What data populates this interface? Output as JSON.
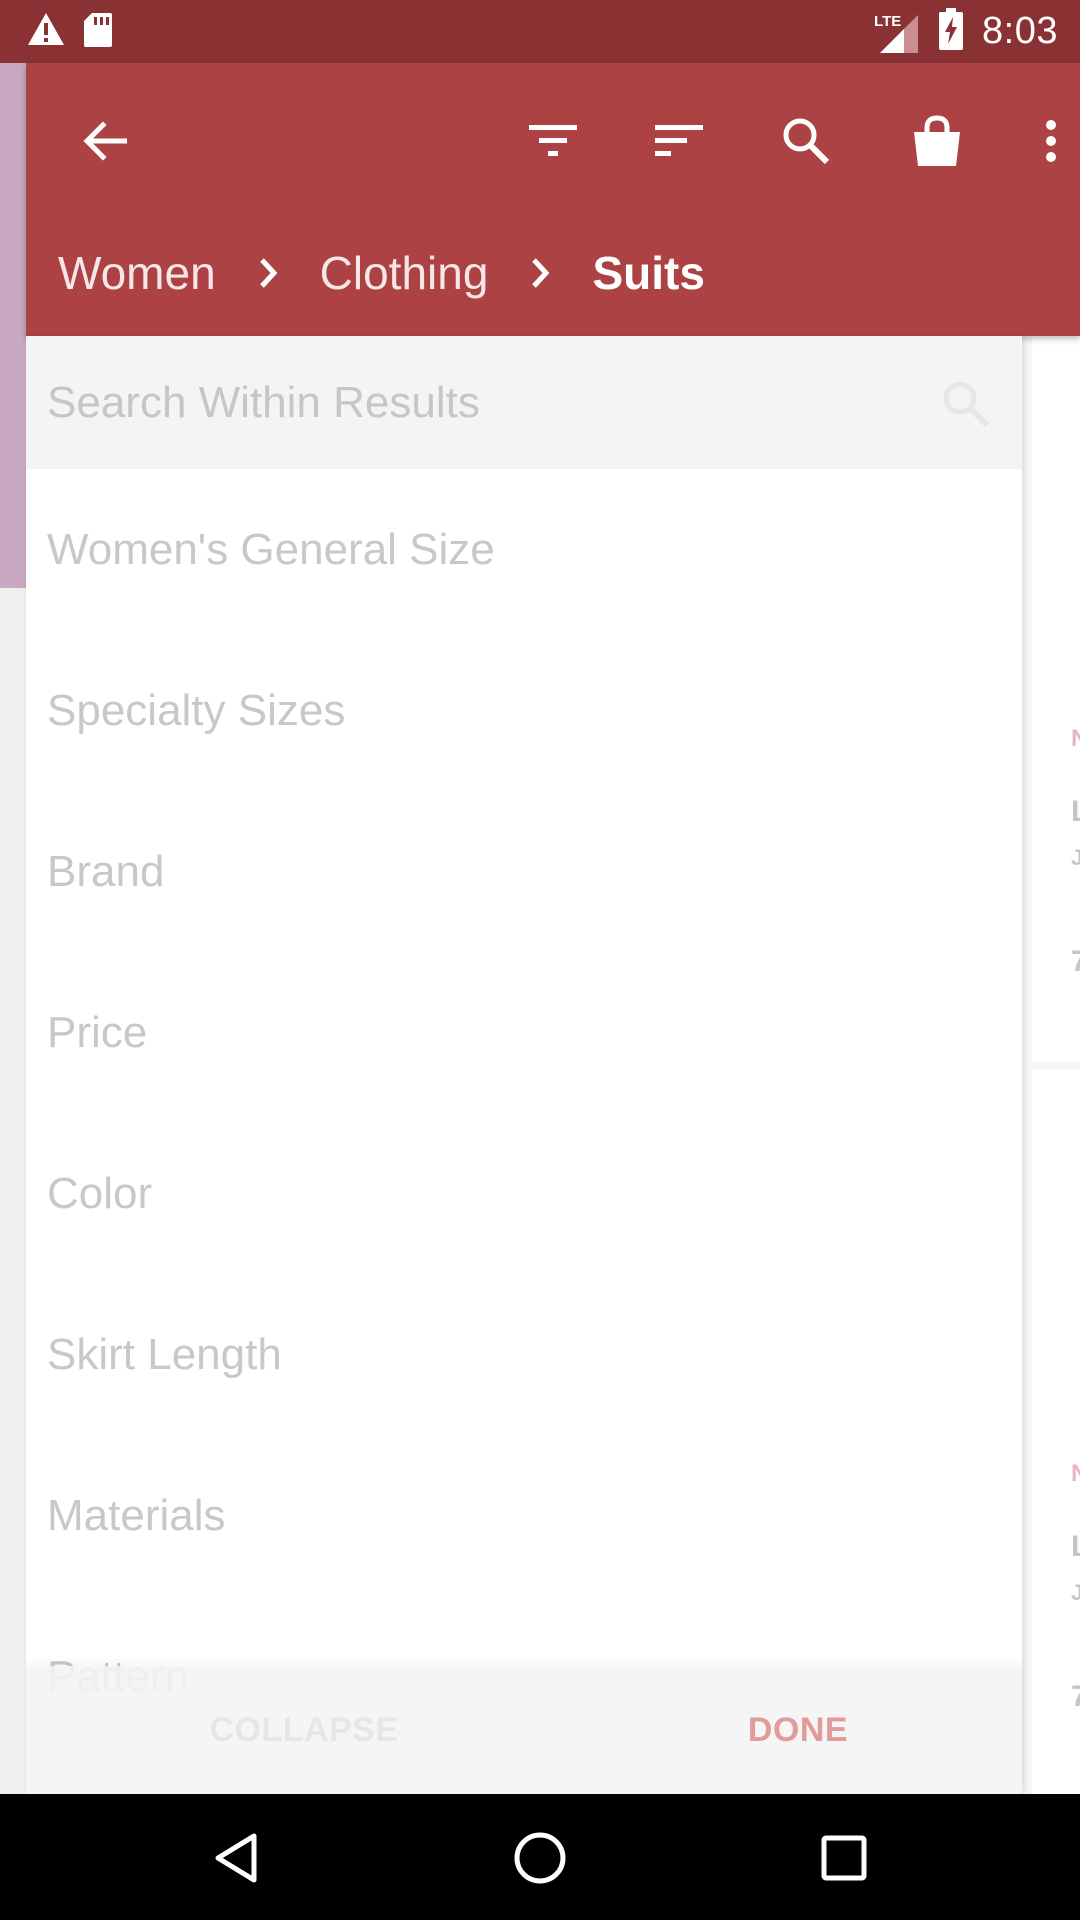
{
  "status_bar": {
    "time": "8:03",
    "network": "LTE",
    "icons": [
      "warning-icon",
      "sd-card-icon",
      "signal-icon",
      "battery-charging-icon"
    ]
  },
  "app_bar": {
    "icons": [
      "back-arrow-icon",
      "filter-icon",
      "sort-icon",
      "search-icon",
      "shopping-bag-icon",
      "more-vert-icon"
    ],
    "breadcrumb": [
      "Women",
      "Clothing",
      "Suits"
    ]
  },
  "filter_drawer": {
    "search_placeholder": "Search Within Results",
    "facets": [
      "Women's General Size",
      "Specialty Sizes",
      "Brand",
      "Price",
      "Color",
      "Skirt Length",
      "Materials",
      "Pattern"
    ],
    "collapse_label": "COLLAPSE",
    "done_label": "DONE"
  },
  "background_page": {
    "fragments": [
      "N",
      "L",
      "J",
      "7",
      "N",
      "L",
      "J",
      "7"
    ]
  },
  "nav_bar": {
    "icons": [
      "back-triangle-icon",
      "home-circle-icon",
      "recents-square-icon"
    ]
  },
  "colors": {
    "status_bar": "#8a3133",
    "app_bar": "#ad4244",
    "accent": "#e39a9b"
  }
}
